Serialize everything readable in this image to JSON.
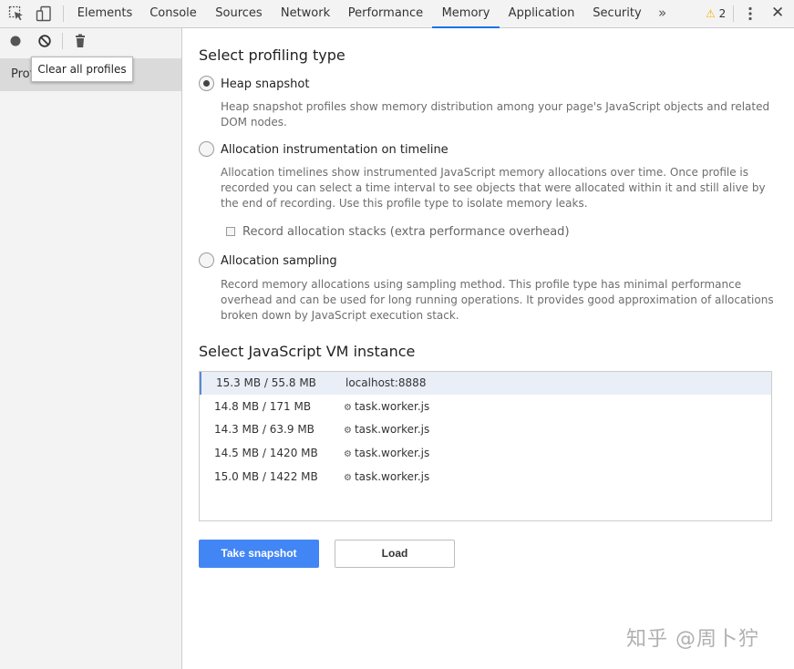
{
  "tabs": [
    {
      "label": "Elements",
      "active": false
    },
    {
      "label": "Console",
      "active": false
    },
    {
      "label": "Sources",
      "active": false
    },
    {
      "label": "Network",
      "active": false
    },
    {
      "label": "Performance",
      "active": false
    },
    {
      "label": "Memory",
      "active": true
    },
    {
      "label": "Application",
      "active": false
    },
    {
      "label": "Security",
      "active": false
    }
  ],
  "more_tabs": "»",
  "warnings": {
    "count": "2",
    "color": "#f4b400"
  },
  "close_glyph": "✕",
  "sidebar": {
    "item_label": "Prof",
    "tooltip": "Clear all profiles"
  },
  "main": {
    "profiling_title": "Select profiling type",
    "options": [
      {
        "label": "Heap snapshot",
        "checked": true,
        "description": "Heap snapshot profiles show memory distribution among your page's JavaScript objects and related DOM nodes."
      },
      {
        "label": "Allocation instrumentation on timeline",
        "checked": false,
        "description": "Allocation timelines show instrumented JavaScript memory allocations over time. Once profile is recorded you can select a time interval to see objects that were allocated within it and still alive by the end of recording. Use this profile type to isolate memory leaks."
      },
      {
        "label": "Allocation sampling",
        "checked": false,
        "description": "Record memory allocations using sampling method. This profile type has minimal performance overhead and can be used for long running operations. It provides good approximation of allocations broken down by JavaScript execution stack."
      }
    ],
    "record_stacks_label": "Record allocation stacks (extra performance overhead)",
    "vm_title": "Select JavaScript VM instance",
    "vm_instances": [
      {
        "memory": "15.3 MB / 55.8 MB",
        "name": "localhost:8888",
        "worker": false,
        "selected": true
      },
      {
        "memory": "14.8 MB / 171 MB",
        "name": "task.worker.js",
        "worker": true,
        "selected": false
      },
      {
        "memory": "14.3 MB / 63.9 MB",
        "name": "task.worker.js",
        "worker": true,
        "selected": false
      },
      {
        "memory": "14.5 MB / 1420 MB",
        "name": "task.worker.js",
        "worker": true,
        "selected": false
      },
      {
        "memory": "15.0 MB / 1422 MB",
        "name": "task.worker.js",
        "worker": true,
        "selected": false
      }
    ],
    "take_snapshot_label": "Take snapshot",
    "load_label": "Load",
    "accent_color": "#4285f4"
  },
  "watermark": "知乎 @周卜狞"
}
